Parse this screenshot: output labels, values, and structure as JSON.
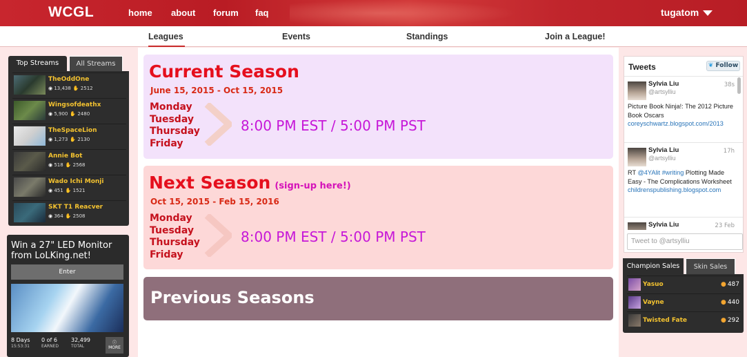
{
  "header": {
    "logo": "WCGL",
    "nav": [
      "home",
      "about",
      "forum",
      "faq"
    ],
    "user": "tugatom"
  },
  "subnav": {
    "items": [
      "Leagues",
      "Events",
      "Standings",
      "Join a League!"
    ],
    "active": "Leagues"
  },
  "streams": {
    "tabs": [
      "Top Streams",
      "All Streams"
    ],
    "items": [
      {
        "name": "TheOddOne",
        "viewers": "13,438",
        "likes": "2512"
      },
      {
        "name": "Wingsofdeathx",
        "viewers": "5,900",
        "likes": "2480"
      },
      {
        "name": "TheSpaceLion",
        "viewers": "1,273",
        "likes": "2130"
      },
      {
        "name": "Annie Bot",
        "viewers": "518",
        "likes": "2568"
      },
      {
        "name": "Wado Ichi Monji",
        "viewers": "451",
        "likes": "1521"
      },
      {
        "name": "SKT T1 Reacver",
        "viewers": "364",
        "likes": "2508"
      }
    ]
  },
  "giveaway": {
    "title": "Win a 27\" LED Monitor from LoLKing.net!",
    "enter_label": "Enter",
    "stats": [
      {
        "value": "8 Days",
        "label": "15:53:31"
      },
      {
        "value": "0 of 6",
        "label": "EARNED"
      },
      {
        "value": "32,499",
        "label": "TOTAL"
      }
    ],
    "more_label": "MORE"
  },
  "current_season": {
    "title": "Current Season",
    "dates": "June 15, 2015 - Oct 15, 2015",
    "days": [
      "Monday",
      "Tuesday",
      "Thursday",
      "Friday"
    ],
    "time": "8:00 PM EST / 5:00 PM PST"
  },
  "next_season": {
    "title": "Next Season",
    "signup": "(sign-up here!)",
    "dates": "Oct 15, 2015 - Feb 15, 2016",
    "days": [
      "Monday",
      "Tuesday",
      "Thursday",
      "Friday"
    ],
    "time": "8:00 PM EST / 5:00 PM PST"
  },
  "previous_seasons": {
    "title": "Previous Seasons"
  },
  "tweets": {
    "heading": "Tweets",
    "follow_label": "Follow",
    "items": [
      {
        "name": "Sylvia Liu",
        "handle": "@artsylliu",
        "time": "38s",
        "text": "Picture Book Ninja!: The 2012 Picture Book Oscars",
        "link": "coreyschwartz.blogspot.com/2013"
      },
      {
        "name": "Sylvia Liu",
        "handle": "@artsylliu",
        "time": "17h",
        "prefix": "RT ",
        "mention": "@4YAlit",
        "tag": "#writing",
        "text": " Plotting Made Easy - The Complications Worksheet",
        "link": "childrenspublishing.blogspot.com"
      },
      {
        "name": "Sylvia Liu",
        "handle": "",
        "time": "23 Feb",
        "text": "",
        "link": ""
      }
    ],
    "input_placeholder": "Tweet to @artsylliu"
  },
  "sales": {
    "tabs": [
      "Champion Sales",
      "Skin Sales"
    ],
    "items": [
      {
        "name": "Yasuo",
        "price": "487"
      },
      {
        "name": "Vayne",
        "price": "440"
      },
      {
        "name": "Twisted Fate",
        "price": "292"
      }
    ]
  },
  "colors": {
    "brand_red": "#c8262e",
    "title_red": "#e50f1d",
    "time_magenta": "#c617d8",
    "stream_gold": "#f3c230"
  }
}
